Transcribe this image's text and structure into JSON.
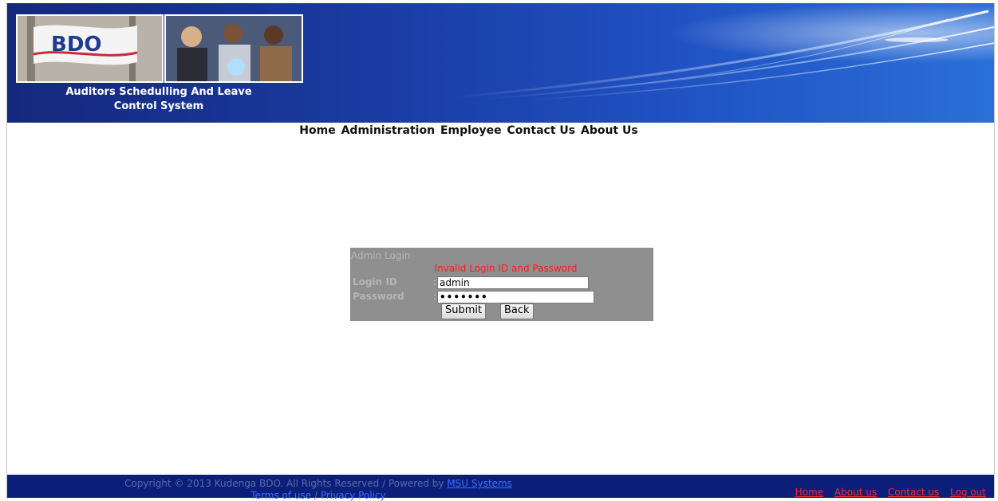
{
  "header": {
    "title_line1": "Auditors Schedulling And Leave",
    "title_line2": "Control System",
    "logo_text": "BDO"
  },
  "nav": {
    "items": [
      "Home",
      "Administration",
      "Employee",
      "Contact Us",
      "About Us"
    ]
  },
  "login": {
    "heading": "Admin Login",
    "error": "Invalid Login ID and Password",
    "login_id_label": "Login ID",
    "password_label": "Password",
    "colon": ":",
    "login_id_value": "admin",
    "password_value": "•••••••",
    "submit_label": "Submit",
    "back_label": "Back"
  },
  "footer": {
    "copyright": "Copyright © 2013 Kudenga BDO. All Rights Reserved / Powered by",
    "powered_link": "MSU Systems",
    "terms": "Terms of use",
    "privacy": "Privacy Policy",
    "links": [
      "Home",
      "About us",
      "Contact us",
      "Log out"
    ]
  },
  "colors": {
    "header_blue": "#1a3aa0",
    "footer_blue": "#0b1f7a",
    "login_bg": "#8f8f8f",
    "error_red": "#ff1a1a",
    "footer_link_red": "#ff2a2a"
  }
}
